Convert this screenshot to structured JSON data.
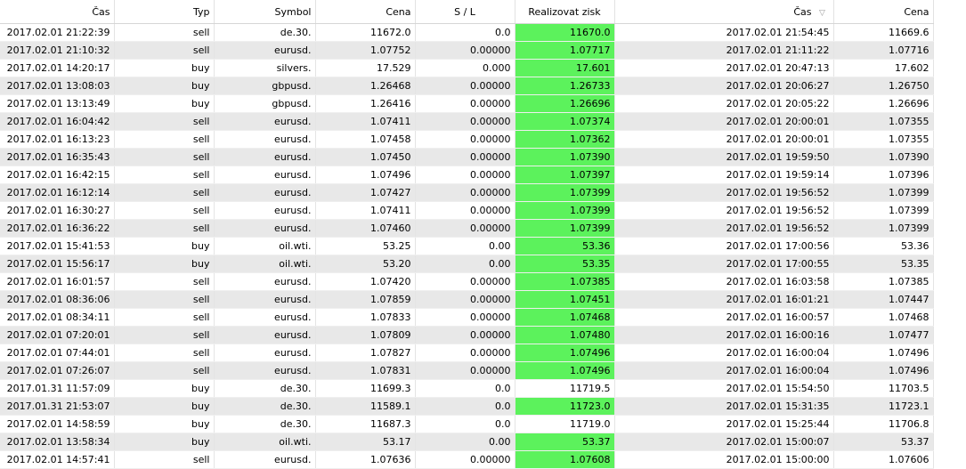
{
  "colors": {
    "take_profit_hit": "#5cf25c",
    "row_alt": "#e8e8e8"
  },
  "headers": {
    "time": "Čas",
    "type": "Typ",
    "symbol": "Symbol",
    "price": "Cena",
    "sl": "S / L",
    "tp": "Realizovat zisk",
    "close_time": "Čas",
    "close_price": "Cena",
    "sort_icon": "sort-descending-icon"
  },
  "rows": [
    {
      "time": "2017.02.01 21:22:39",
      "type": "sell",
      "symbol": "de.30.",
      "price": "11672.0",
      "sl": "0.0",
      "tp": "11670.0",
      "tp_hit": true,
      "close_time": "2017.02.01 21:54:45",
      "close_price": "11669.6"
    },
    {
      "time": "2017.02.01 21:10:32",
      "type": "sell",
      "symbol": "eurusd.",
      "price": "1.07752",
      "sl": "0.00000",
      "tp": "1.07717",
      "tp_hit": true,
      "close_time": "2017.02.01 21:11:22",
      "close_price": "1.07716"
    },
    {
      "time": "2017.02.01 14:20:17",
      "type": "buy",
      "symbol": "silvers.",
      "price": "17.529",
      "sl": "0.000",
      "tp": "17.601",
      "tp_hit": true,
      "close_time": "2017.02.01 20:47:13",
      "close_price": "17.602"
    },
    {
      "time": "2017.02.01 13:08:03",
      "type": "buy",
      "symbol": "gbpusd.",
      "price": "1.26468",
      "sl": "0.00000",
      "tp": "1.26733",
      "tp_hit": true,
      "close_time": "2017.02.01 20:06:27",
      "close_price": "1.26750"
    },
    {
      "time": "2017.02.01 13:13:49",
      "type": "buy",
      "symbol": "gbpusd.",
      "price": "1.26416",
      "sl": "0.00000",
      "tp": "1.26696",
      "tp_hit": true,
      "close_time": "2017.02.01 20:05:22",
      "close_price": "1.26696"
    },
    {
      "time": "2017.02.01 16:04:42",
      "type": "sell",
      "symbol": "eurusd.",
      "price": "1.07411",
      "sl": "0.00000",
      "tp": "1.07374",
      "tp_hit": true,
      "close_time": "2017.02.01 20:00:01",
      "close_price": "1.07355"
    },
    {
      "time": "2017.02.01 16:13:23",
      "type": "sell",
      "symbol": "eurusd.",
      "price": "1.07458",
      "sl": "0.00000",
      "tp": "1.07362",
      "tp_hit": true,
      "close_time": "2017.02.01 20:00:01",
      "close_price": "1.07355"
    },
    {
      "time": "2017.02.01 16:35:43",
      "type": "sell",
      "symbol": "eurusd.",
      "price": "1.07450",
      "sl": "0.00000",
      "tp": "1.07390",
      "tp_hit": true,
      "close_time": "2017.02.01 19:59:50",
      "close_price": "1.07390"
    },
    {
      "time": "2017.02.01 16:42:15",
      "type": "sell",
      "symbol": "eurusd.",
      "price": "1.07496",
      "sl": "0.00000",
      "tp": "1.07397",
      "tp_hit": true,
      "close_time": "2017.02.01 19:59:14",
      "close_price": "1.07396"
    },
    {
      "time": "2017.02.01 16:12:14",
      "type": "sell",
      "symbol": "eurusd.",
      "price": "1.07427",
      "sl": "0.00000",
      "tp": "1.07399",
      "tp_hit": true,
      "close_time": "2017.02.01 19:56:52",
      "close_price": "1.07399"
    },
    {
      "time": "2017.02.01 16:30:27",
      "type": "sell",
      "symbol": "eurusd.",
      "price": "1.07411",
      "sl": "0.00000",
      "tp": "1.07399",
      "tp_hit": true,
      "close_time": "2017.02.01 19:56:52",
      "close_price": "1.07399"
    },
    {
      "time": "2017.02.01 16:36:22",
      "type": "sell",
      "symbol": "eurusd.",
      "price": "1.07460",
      "sl": "0.00000",
      "tp": "1.07399",
      "tp_hit": true,
      "close_time": "2017.02.01 19:56:52",
      "close_price": "1.07399"
    },
    {
      "time": "2017.02.01 15:41:53",
      "type": "buy",
      "symbol": "oil.wti.",
      "price": "53.25",
      "sl": "0.00",
      "tp": "53.36",
      "tp_hit": true,
      "close_time": "2017.02.01 17:00:56",
      "close_price": "53.36"
    },
    {
      "time": "2017.02.01 15:56:17",
      "type": "buy",
      "symbol": "oil.wti.",
      "price": "53.20",
      "sl": "0.00",
      "tp": "53.35",
      "tp_hit": true,
      "close_time": "2017.02.01 17:00:55",
      "close_price": "53.35"
    },
    {
      "time": "2017.02.01 16:01:57",
      "type": "sell",
      "symbol": "eurusd.",
      "price": "1.07420",
      "sl": "0.00000",
      "tp": "1.07385",
      "tp_hit": true,
      "close_time": "2017.02.01 16:03:58",
      "close_price": "1.07385"
    },
    {
      "time": "2017.02.01 08:36:06",
      "type": "sell",
      "symbol": "eurusd.",
      "price": "1.07859",
      "sl": "0.00000",
      "tp": "1.07451",
      "tp_hit": true,
      "close_time": "2017.02.01 16:01:21",
      "close_price": "1.07447"
    },
    {
      "time": "2017.02.01 08:34:11",
      "type": "sell",
      "symbol": "eurusd.",
      "price": "1.07833",
      "sl": "0.00000",
      "tp": "1.07468",
      "tp_hit": true,
      "close_time": "2017.02.01 16:00:57",
      "close_price": "1.07468"
    },
    {
      "time": "2017.02.01 07:20:01",
      "type": "sell",
      "symbol": "eurusd.",
      "price": "1.07809",
      "sl": "0.00000",
      "tp": "1.07480",
      "tp_hit": true,
      "close_time": "2017.02.01 16:00:16",
      "close_price": "1.07477"
    },
    {
      "time": "2017.02.01 07:44:01",
      "type": "sell",
      "symbol": "eurusd.",
      "price": "1.07827",
      "sl": "0.00000",
      "tp": "1.07496",
      "tp_hit": true,
      "close_time": "2017.02.01 16:00:04",
      "close_price": "1.07496"
    },
    {
      "time": "2017.02.01 07:26:07",
      "type": "sell",
      "symbol": "eurusd.",
      "price": "1.07831",
      "sl": "0.00000",
      "tp": "1.07496",
      "tp_hit": true,
      "close_time": "2017.02.01 16:00:04",
      "close_price": "1.07496"
    },
    {
      "time": "2017.01.31 11:57:09",
      "type": "buy",
      "symbol": "de.30.",
      "price": "11699.3",
      "sl": "0.0",
      "tp": "11719.5",
      "tp_hit": false,
      "close_time": "2017.02.01 15:54:50",
      "close_price": "11703.5"
    },
    {
      "time": "2017.01.31 21:53:07",
      "type": "buy",
      "symbol": "de.30.",
      "price": "11589.1",
      "sl": "0.0",
      "tp": "11723.0",
      "tp_hit": true,
      "close_time": "2017.02.01 15:31:35",
      "close_price": "11723.1"
    },
    {
      "time": "2017.02.01 14:58:59",
      "type": "buy",
      "symbol": "de.30.",
      "price": "11687.3",
      "sl": "0.0",
      "tp": "11719.0",
      "tp_hit": false,
      "close_time": "2017.02.01 15:25:44",
      "close_price": "11706.8"
    },
    {
      "time": "2017.02.01 13:58:34",
      "type": "buy",
      "symbol": "oil.wti.",
      "price": "53.17",
      "sl": "0.00",
      "tp": "53.37",
      "tp_hit": true,
      "close_time": "2017.02.01 15:00:07",
      "close_price": "53.37"
    },
    {
      "time": "2017.02.01 14:57:41",
      "type": "sell",
      "symbol": "eurusd.",
      "price": "1.07636",
      "sl": "0.00000",
      "tp": "1.07608",
      "tp_hit": true,
      "close_time": "2017.02.01 15:00:00",
      "close_price": "1.07606"
    }
  ]
}
